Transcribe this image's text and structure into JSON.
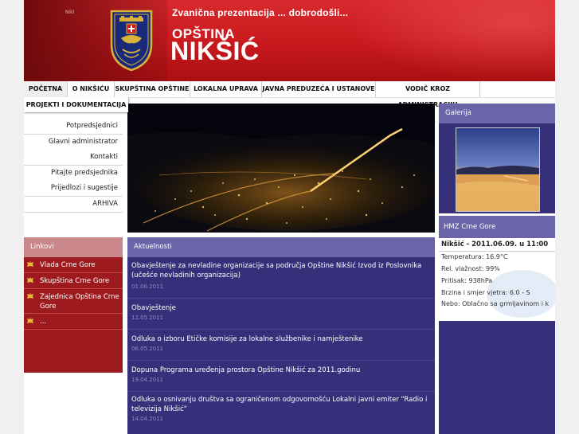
{
  "header": {
    "tagline": "Zvanična prezentacija ... dobrodošli...",
    "title_small": "OPŠTINA",
    "title_big": "NIKŠIĆ",
    "small_label": "Nikl"
  },
  "nav": {
    "items": [
      {
        "label": "POČETNA"
      },
      {
        "label": "O NIKŠIĆU"
      },
      {
        "label": "SKUPŠTINA OPŠTINE"
      },
      {
        "label": "LOKALNA UPRAVA"
      },
      {
        "label": "JAVNA PREDUZEĆA I USTANOVE"
      },
      {
        "label": "VODIČ KROZ ADMINISTRACIJU"
      },
      {
        "label": "PROJEKTI I DOKUMENTACIJA"
      }
    ]
  },
  "left_menu": {
    "items": [
      {
        "label": "Potpredsjednici"
      },
      {
        "label": "Glavni administrator"
      },
      {
        "label": "Kontakti"
      },
      {
        "label": "Pitajte predsjednika"
      },
      {
        "label": "Prijedlozi i sugestije"
      },
      {
        "label": "ARHIVA"
      }
    ]
  },
  "links": {
    "heading": "Linkovi",
    "items": [
      {
        "label": "Vlada Crne Gore"
      },
      {
        "label": "Skupština Crne Gore"
      },
      {
        "label": "Zajednica Opština Crne Gore"
      },
      {
        "label": "..."
      }
    ]
  },
  "news": {
    "heading": "Aktuelnosti",
    "items": [
      {
        "title": "Obavještenje za nevladine organizacije sa područja Opštine Nikšić Izvod iz Poslovnika (učešće nevladinih organizacija)",
        "date": "01.06.2011"
      },
      {
        "title": "Obavještenje",
        "date": "12.05.2011"
      },
      {
        "title": "Odluka o izboru Etičke komisije za lokalne službenike i namještenike",
        "date": "06.05.2011"
      },
      {
        "title": "Dopuna Programa uređenja prostora Opštine Nikšić za 2011.godinu",
        "date": "19.04.2011"
      },
      {
        "title": "Odluka o osnivanju društva sa ograničenom odgovornošću Lokalni javni emiter \"Radio i televizija Nikšić\"",
        "date": "14.04.2011"
      }
    ]
  },
  "gallery": {
    "heading": "Galerija"
  },
  "hmz": {
    "heading": "HMZ Crne Gore",
    "station_line": "Nikšić - 2011.06.09. u 11:00",
    "lines": [
      "Temperatura: 16.9°C",
      "Rel. vlažnost: 99%",
      "Pritisak: 938hPa",
      "Brzina i smjer vjetra: 6.0 - S",
      "Nebo: Oblačno sa grmljavinom i k"
    ]
  },
  "colors": {
    "header_red": "#c8191d",
    "panel_purple": "#36307a",
    "panel_head_purple": "#6a64a8",
    "links_red": "#9d1b1f",
    "links_head_pink": "#c9878a"
  }
}
